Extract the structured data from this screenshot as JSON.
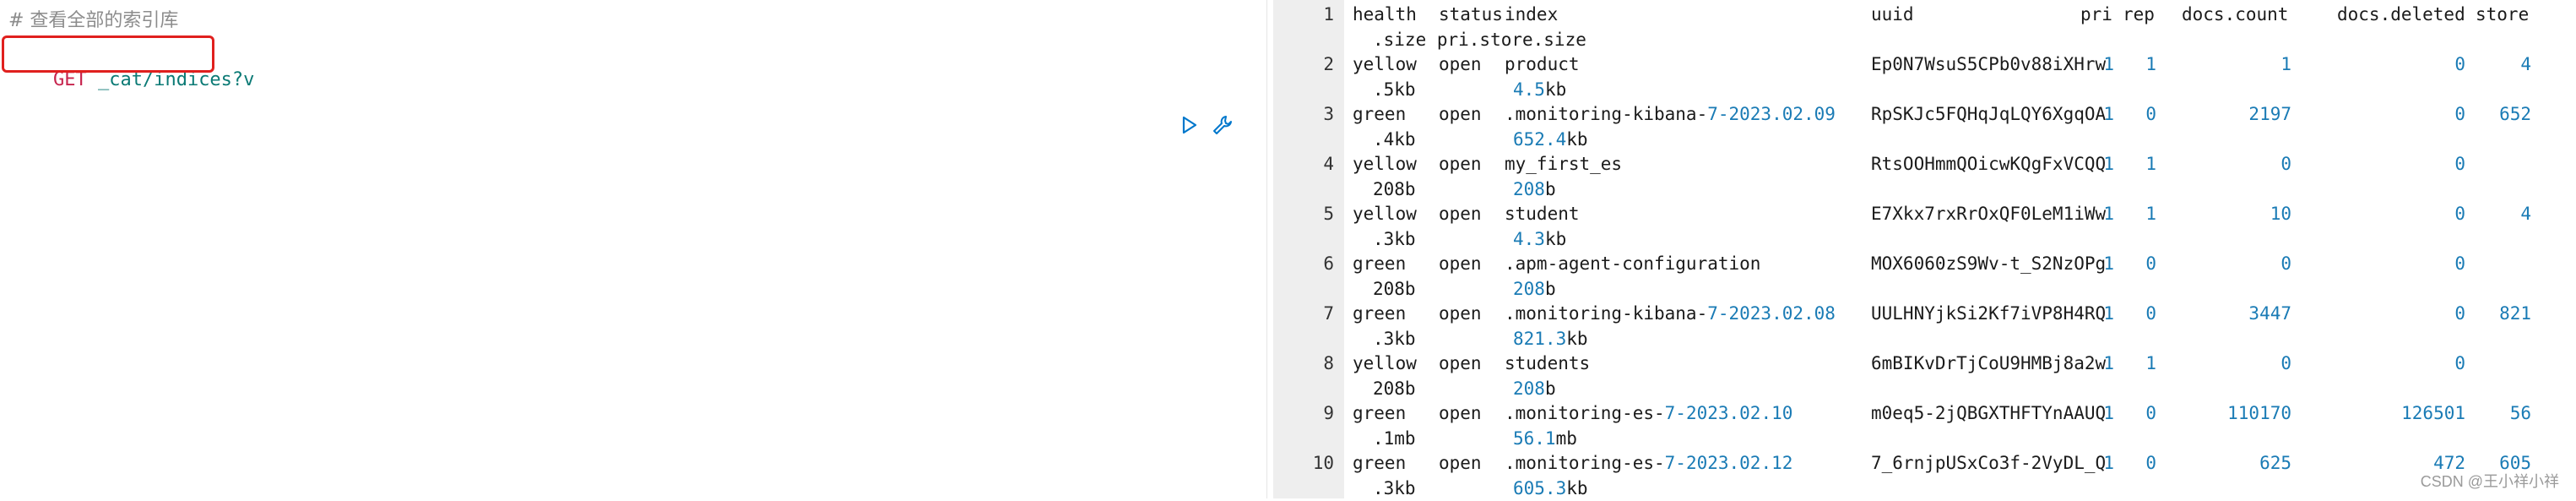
{
  "editor": {
    "comment": "# 查看全部的索引库",
    "verb": "GET",
    "path": "_cat/indices?v"
  },
  "output": {
    "header": {
      "line": "1",
      "health": "health",
      "status": "status",
      "index": "index",
      "uuid": "uuid",
      "pri": "pri",
      "rep": "rep",
      "docs_count": "docs.count",
      "docs_deleted": "docs.deleted",
      "store": "store",
      "cont": ".size pri.store.size"
    },
    "rows": [
      {
        "line": "2",
        "health": "yellow",
        "status": "open",
        "index_pre": "product",
        "index_date": "",
        "uuid": "Ep0N7WsuS5CPb0v88iXHrw",
        "pri": "1",
        "rep": "1",
        "docs_count": "1",
        "docs_deleted": "0",
        "store": "4",
        "cont_a": ".5kb",
        "cont_b": "4.5kb"
      },
      {
        "line": "3",
        "health": "green",
        "status": "open",
        "index_pre": ".monitoring-kibana-",
        "index_date": "7-2023.02.09",
        "uuid": "RpSKJc5FQHqJqLQY6XgqOA",
        "pri": "1",
        "rep": "0",
        "docs_count": "2197",
        "docs_deleted": "0",
        "store": "652",
        "cont_a": ".4kb",
        "cont_b": "652.4kb"
      },
      {
        "line": "4",
        "health": "yellow",
        "status": "open",
        "index_pre": "my_first_es",
        "index_date": "",
        "uuid": "RtsOOHmmQOicwKQgFxVCQQ",
        "pri": "1",
        "rep": "1",
        "docs_count": "0",
        "docs_deleted": "0",
        "store": "",
        "cont_a": "208b",
        "cont_b": "208b"
      },
      {
        "line": "5",
        "health": "yellow",
        "status": "open",
        "index_pre": "student",
        "index_date": "",
        "uuid": "E7Xkx7rxRrOxQF0LeM1iWw",
        "pri": "1",
        "rep": "1",
        "docs_count": "10",
        "docs_deleted": "0",
        "store": "4",
        "cont_a": ".3kb",
        "cont_b": "4.3kb"
      },
      {
        "line": "6",
        "health": "green",
        "status": "open",
        "index_pre": ".apm-agent-configuration",
        "index_date": "",
        "uuid": "MOX6060zS9Wv-t_S2NzOPg",
        "pri": "1",
        "rep": "0",
        "docs_count": "0",
        "docs_deleted": "0",
        "store": "",
        "cont_a": "208b",
        "cont_b": "208b"
      },
      {
        "line": "7",
        "health": "green",
        "status": "open",
        "index_pre": ".monitoring-kibana-",
        "index_date": "7-2023.02.08",
        "uuid": "UULHNYjkSi2Kf7iVP8H4RQ",
        "pri": "1",
        "rep": "0",
        "docs_count": "3447",
        "docs_deleted": "0",
        "store": "821",
        "cont_a": ".3kb",
        "cont_b": "821.3kb"
      },
      {
        "line": "8",
        "health": "yellow",
        "status": "open",
        "index_pre": "students",
        "index_date": "",
        "uuid": "6mBIKvDrTjCoU9HMBj8a2w",
        "pri": "1",
        "rep": "1",
        "docs_count": "0",
        "docs_deleted": "0",
        "store": "",
        "cont_a": "208b",
        "cont_b": "208b"
      },
      {
        "line": "9",
        "health": "green",
        "status": "open",
        "index_pre": ".monitoring-es-",
        "index_date": "7-2023.02.10",
        "uuid": "m0eq5-2jQBGXTHFTYnAAUQ",
        "pri": "1",
        "rep": "0",
        "docs_count": "110170",
        "docs_deleted": "126501",
        "store": "56",
        "cont_a": ".1mb",
        "cont_b": "56.1mb"
      },
      {
        "line": "10",
        "health": "green",
        "status": "open",
        "index_pre": ".monitoring-es-",
        "index_date": "7-2023.02.12",
        "uuid": "7_6rnjpUSxCo3f-2VyDL_Q",
        "pri": "1",
        "rep": "0",
        "docs_count": "625",
        "docs_deleted": "472",
        "store": "605",
        "cont_a": ".3kb",
        "cont_b": "605.3kb"
      }
    ]
  },
  "watermark": "CSDN @王小祥小祥",
  "icons": {
    "run": "play-icon",
    "settings": "wrench-icon"
  },
  "colors": {
    "highlight": "#e0201e",
    "verb": "#c7254e",
    "path": "#0b7a75",
    "number": "#1a7bb5"
  }
}
